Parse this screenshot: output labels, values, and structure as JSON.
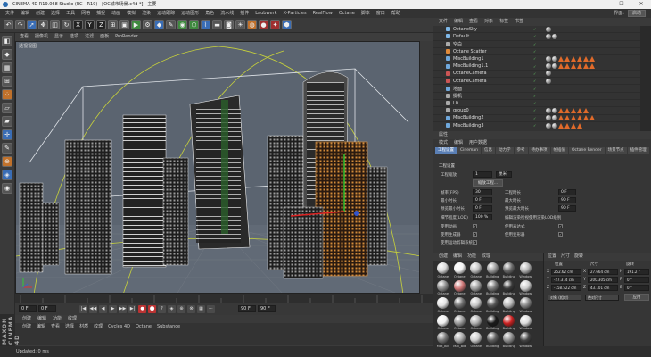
{
  "window": {
    "title": "CINEMA 4D R19.068 Studio (RC - R19) - [OC城市场景.c4d *] - 主要",
    "minimize": "—",
    "maximize": "☐",
    "close": "✕"
  },
  "menubar": {
    "items": [
      "文件",
      "编辑",
      "创建",
      "选择",
      "工具",
      "网格",
      "捕捉",
      "动画",
      "模拟",
      "渲染",
      "运动跟踪",
      "运动图形",
      "角色",
      "流水线",
      "插件",
      "Laubwerk",
      "X-Particles",
      "RealFlow",
      "Octane",
      "脚本",
      "窗口",
      "帮助"
    ],
    "layout_label": "界面:",
    "layout_value": "启动"
  },
  "toolbar": {
    "icons": [
      "undo-icon",
      "redo-icon",
      "select-icon",
      "move-icon",
      "scale-icon",
      "rotate-icon",
      "axis-x-icon",
      "axis-y-icon",
      "axis-z-icon",
      "coord-icon",
      "render-view-icon",
      "render-picture-icon",
      "render-settings-icon",
      "cube-icon",
      "pen-icon",
      "subdivide-icon",
      "array-icon",
      "deformer-icon",
      "floor-icon",
      "camera-icon",
      "light-icon",
      "octane-live-icon",
      "octane-material-icon",
      "octane-settings-icon",
      "octane-tag-icon"
    ],
    "glyphs": [
      "↶",
      "↷",
      "➚",
      "✥",
      "◫",
      "↻",
      "X",
      "Y",
      "Z",
      "⊞",
      "▣",
      "▶",
      "⚙",
      "◆",
      "✎",
      "◉",
      "⬡",
      "⌇",
      "▬",
      "◙",
      "☀",
      "◍",
      "●",
      "✦",
      "⬢"
    ]
  },
  "viewport": {
    "menu": [
      "查看",
      "摄像机",
      "显示",
      "选项",
      "过滤",
      "面板",
      "ProRender"
    ],
    "label": "透视视图",
    "bg_color": "#5b6470",
    "grid_color": "#888888"
  },
  "timeline": {
    "frame_start": "0 F",
    "frame_current": "0 F",
    "frame_end": "90 F",
    "frame_max": "90 F",
    "playback_glyphs": [
      "|◀",
      "◀◀",
      "◀",
      "▶",
      "▶▶",
      "▶|",
      "●",
      "⬤",
      "?",
      "◈",
      "⊕",
      "⊗",
      "▦",
      "⋯"
    ]
  },
  "material_bar": {
    "menu": [
      "创建",
      "编辑",
      "功能",
      "纹理"
    ],
    "submenu": [
      "创建",
      "编辑",
      "查看",
      "选择",
      "材质",
      "纹理",
      "Cycles 4D",
      "Octane",
      "Substance"
    ]
  },
  "maxon": {
    "logo": "MAXON CINEMA 4D"
  },
  "status": {
    "text": "Updated: 0 ms"
  },
  "object_manager": {
    "menu": [
      "文件",
      "编辑",
      "查看",
      "对象",
      "标签",
      "书签"
    ],
    "rows": [
      {
        "name": "OctaneSky",
        "icon_color": "#7fb8e8",
        "tags": [
          "sphere"
        ]
      },
      {
        "name": "Default",
        "icon_color": "#7fb8e8",
        "tags": [
          "sphere",
          "sphere"
        ]
      },
      {
        "name": "空白",
        "icon_color": "#aaaaaa",
        "tags": []
      },
      {
        "name": "Octane Scatter",
        "icon_color": "#e08a3a",
        "tags": []
      },
      {
        "name": "MiscBuilding1",
        "icon_color": "#6fa8dc",
        "tags": [
          "sphere",
          "sphere",
          "tri",
          "tri",
          "tri",
          "tri",
          "tri",
          "tri"
        ]
      },
      {
        "name": "MiscBuilding1.1",
        "icon_color": "#6fa8dc",
        "tags": [
          "sphere",
          "sphere",
          "tri",
          "tri",
          "tri",
          "tri",
          "tri",
          "tri"
        ]
      },
      {
        "name": "OctaneCamera",
        "icon_color": "#c55",
        "tags": [
          "sphere"
        ]
      },
      {
        "name": "OctaneCamera",
        "icon_color": "#c55",
        "tags": [
          "sphere"
        ]
      },
      {
        "name": "地面",
        "icon_color": "#6fa8dc",
        "tags": []
      },
      {
        "name": "摄机",
        "icon_color": "#aaaaaa",
        "tags": []
      },
      {
        "name": "L0",
        "icon_color": "#aaaaaa",
        "tags": []
      },
      {
        "name": "group0",
        "icon_color": "#aaaaaa",
        "tags": [
          "sphere",
          "sphere",
          "tri",
          "tri",
          "tri",
          "tri",
          "tri"
        ]
      },
      {
        "name": "MiscBuilding2",
        "icon_color": "#6fa8dc",
        "tags": [
          "sphere",
          "sphere",
          "tri",
          "tri",
          "tri",
          "tri",
          "tri",
          "tri"
        ]
      },
      {
        "name": "MiscBuilding3",
        "icon_color": "#6fa8dc",
        "tags": [
          "sphere",
          "sphere",
          "tri",
          "tri",
          "tri",
          "tri"
        ]
      }
    ]
  },
  "attributes": {
    "title": "属性",
    "menu": [
      "模式",
      "编辑",
      "用户数据"
    ],
    "tabs": [
      "工程设置",
      "Cineman",
      "信息",
      "动力学",
      "参考",
      "待办事项",
      "帧插值",
      "Octane Render",
      "场景节点",
      "插件管理"
    ],
    "active_tab": 0,
    "section": "工程设置",
    "scale_label": "工程缩放",
    "scale_value": "1",
    "scale_unit": "厘米",
    "scale_button": "缩放工程...",
    "fps_label": "帧率(FPS)",
    "fps_value": "30",
    "time_label": "工程时长",
    "time_value": "0 F",
    "min_label": "最小时长",
    "min_value": "0 F",
    "max_label": "最大时长",
    "max_value": "90 F",
    "pmin_label": "预览最小时长",
    "pmin_value": "0 F",
    "pmax_label": "预览最大时长",
    "pmax_value": "90 F",
    "lod_label": "细节程度(LOD)",
    "lod_value": "100 %",
    "lod_check_label": "编辑渲染检视使用渲染LOD级别",
    "c1": "使用动画",
    "c2": "使用表达式",
    "c3": "使用生成器",
    "c4": "使用变形器",
    "c5": "使用运动剪辑系统"
  },
  "materials": {
    "menu": [
      "创建",
      "编辑",
      "功能",
      "纹理"
    ],
    "items": [
      {
        "name": "Octane",
        "color": "#d8d8d8"
      },
      {
        "name": "Octane",
        "color": "#f2f2f2"
      },
      {
        "name": "Octane",
        "color": "#c0c0c0"
      },
      {
        "name": "Building",
        "color": "#9a9a9a"
      },
      {
        "name": "Building",
        "color": "#6b6b6b"
      },
      {
        "name": "Window",
        "color": "#b5b5b5"
      },
      {
        "name": "Octane",
        "color": "#8c8c8c"
      },
      {
        "name": "Octane",
        "color": "#cf7777"
      },
      {
        "name": "Octane",
        "color": "#a0a0a0"
      },
      {
        "name": "Building",
        "color": "#7a7a7a"
      },
      {
        "name": "Building",
        "color": "#3a3a3a"
      },
      {
        "name": "Window",
        "color": "#d0d0d0"
      },
      {
        "name": "Octane",
        "color": "#e5e5e5"
      },
      {
        "name": "Octane",
        "color": "#707070"
      },
      {
        "name": "Octane",
        "color": "#c8c8c8"
      },
      {
        "name": "Building",
        "color": "#555555"
      },
      {
        "name": "Building",
        "color": "#bbbbbb"
      },
      {
        "name": "Window",
        "color": "#888888"
      },
      {
        "name": "Octane",
        "color": "#f0f0f0"
      },
      {
        "name": "Octane",
        "color": "#999999"
      },
      {
        "name": "Octane",
        "color": "#b0b0b0"
      },
      {
        "name": "Building",
        "color": "#1a1a1a"
      },
      {
        "name": "Building",
        "color": "#cc2222"
      },
      {
        "name": "Window",
        "color": "#dddddd"
      },
      {
        "name": "Mat_Bld",
        "color": "#777777"
      },
      {
        "name": "Mat_Bld",
        "color": "#aaaaaa"
      },
      {
        "name": "Octane",
        "color": "#cccccc"
      },
      {
        "name": "Building",
        "color": "#5f5f5f"
      },
      {
        "name": "Building",
        "color": "#909090"
      },
      {
        "name": "Window",
        "color": "#444444"
      }
    ]
  },
  "coordinates": {
    "menu": [
      "位置",
      "尺寸",
      "旋转"
    ],
    "pos_head": "位置",
    "size_head": "尺寸",
    "rot_head": "旋转",
    "x_label": "X",
    "y_label": "Y",
    "z_label": "Z",
    "h_label": "H",
    "p_label": "P",
    "b_label": "B",
    "px": "252.62 cm",
    "py": "-27.314 cm",
    "pz": "-158.522 cm",
    "sx": "27.664 cm",
    "sy": "200.305 cm",
    "sz": "43.101 cm",
    "rh": "191.2 °",
    "rp": "0 °",
    "rb": "0 °",
    "mode": "对象 (相对)",
    "size_mode": "绝对尺寸",
    "apply": "应用"
  }
}
